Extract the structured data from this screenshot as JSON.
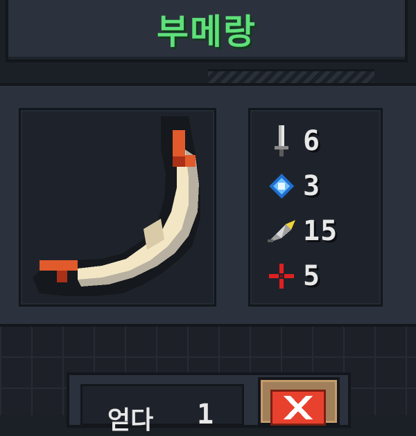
{
  "weapon": {
    "name": "부메랑",
    "name_color": "#5fe07a"
  },
  "stats": [
    {
      "icon": "sword-icon",
      "label": "damage",
      "value": "6"
    },
    {
      "icon": "energy-crystal-icon",
      "label": "energy",
      "value": "3"
    },
    {
      "icon": "feather-icon",
      "label": "speed",
      "value": "15"
    },
    {
      "icon": "crosshair-icon",
      "label": "accuracy",
      "value": "5"
    }
  ],
  "ammo": {
    "label": "얻다",
    "value": "1"
  },
  "colors": {
    "panel": "#2b323d",
    "box": "#1e232b",
    "outline": "#13161b",
    "close": "#e8422e"
  }
}
